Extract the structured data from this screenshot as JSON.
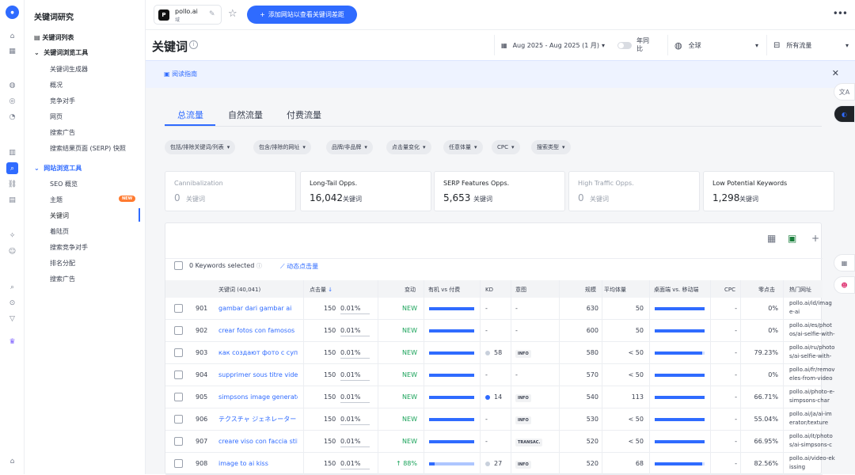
{
  "sidebar": {
    "title": "关键词研究",
    "sections": [
      {
        "label": "关键词列表"
      },
      {
        "label": "关键词浏览工具",
        "items": [
          "关键词生成器",
          "概况",
          "竞争对手",
          "网页",
          "搜索广告",
          "搜索结果页面 (SERP) 快照"
        ]
      },
      {
        "label": "网站浏览工具",
        "items": [
          "SEO 概览",
          "主题",
          "关键词",
          "着陆页",
          "搜索竞争对手",
          "排名分配",
          "搜索广告"
        ]
      }
    ],
    "new_badge": "NEW"
  },
  "topbar": {
    "domain": "pollo.ai",
    "domain_sub": "域",
    "add_button": "添加网站以查看关键词差距"
  },
  "header": {
    "title": "关键词",
    "date": "Aug 2025 - Aug 2025 (1 月)",
    "compare": "年同比",
    "region": "全球",
    "traffic": "所有流量"
  },
  "guide": {
    "label": "阅读指南"
  },
  "tabs": [
    "总流量",
    "自然流量",
    "付费流量"
  ],
  "filters": [
    "包括/排除关键词/列表",
    "包含/排除的网址",
    "品牌/非品牌",
    "点击量变化",
    "任意体量",
    "CPC",
    "搜索类型"
  ],
  "cards": [
    {
      "label": "Cannibalization",
      "value": "0",
      "unit": "关键词",
      "muted": true
    },
    {
      "label": "Long-Tail Opps.",
      "value": "16,042",
      "unit": "关键词",
      "muted": false
    },
    {
      "label": "SERP Features Opps.",
      "value": "5,653",
      "unit": "关键词",
      "muted": false
    },
    {
      "label": "High Traffic Opps.",
      "value": "0",
      "unit": "关键词",
      "muted": true
    },
    {
      "label": "Low Potential Keywords",
      "value": "1,298",
      "unit": "关键词",
      "muted": false
    }
  ],
  "table": {
    "selected": "0 Keywords selected",
    "dynamic": "动态点击量",
    "headers": [
      "关键词 (40,041)",
      "点击量",
      "变动",
      "有机 vs 付费",
      "KD",
      "意图",
      "规模",
      "平均体量",
      "桌面端 vs. 移动端",
      "CPC",
      "零点击",
      "热门网址"
    ],
    "rows": [
      {
        "n": "901",
        "kw": "gambar dari gambar ai",
        "clicks": "150",
        "share": "0.01%",
        "change": "NEW",
        "organic": 1.0,
        "kd": "-",
        "kd_color": "",
        "intent": "-",
        "volume": "630",
        "avg": "50",
        "desktop": 1.0,
        "cpc": "-",
        "zero": "0%",
        "url": "pollo.ai/id/image-ai"
      },
      {
        "n": "902",
        "kw": "crear fotos con famosos",
        "clicks": "150",
        "share": "0.01%",
        "change": "NEW",
        "organic": 1.0,
        "kd": "-",
        "kd_color": "",
        "intent": "-",
        "volume": "600",
        "avg": "50",
        "desktop": 1.0,
        "cpc": "-",
        "zero": "0%",
        "url": "pollo.ai/es/photos/ai-selfie-with-"
      },
      {
        "n": "903",
        "kw": "как создают фото с суперзвёздами",
        "clicks": "150",
        "share": "0.01%",
        "change": "NEW",
        "organic": 1.0,
        "kd": "58",
        "kd_color": "#c8d0dc",
        "intent": "INFO",
        "volume": "580",
        "avg": "< 50",
        "desktop": 0.95,
        "cpc": "-",
        "zero": "79.23%",
        "url": "pollo.ai/ru/photos/ai-selfie-with-"
      },
      {
        "n": "904",
        "kw": "supprimer sous titre video",
        "clicks": "150",
        "share": "0.01%",
        "change": "NEW",
        "organic": 1.0,
        "kd": "-",
        "kd_color": "",
        "intent": "-",
        "volume": "570",
        "avg": "< 50",
        "desktop": 1.0,
        "cpc": "-",
        "zero": "0%",
        "url": "pollo.ai/fr/removeles-from-video"
      },
      {
        "n": "905",
        "kw": "simpsons image generator",
        "clicks": "150",
        "share": "0.01%",
        "change": "NEW",
        "organic": 1.0,
        "kd": "14",
        "kd_color": "#2f6bff",
        "intent": "INFO",
        "volume": "540",
        "avg": "113",
        "desktop": 1.0,
        "cpc": "-",
        "zero": "66.71%",
        "url": "pollo.ai/photo-e-simpsons-char"
      },
      {
        "n": "906",
        "kw": "テクスチャ ジェネレーター",
        "clicks": "150",
        "share": "0.01%",
        "change": "NEW",
        "organic": 1.0,
        "kd": "-",
        "kd_color": "",
        "intent": "INFO",
        "volume": "530",
        "avg": "< 50",
        "desktop": 1.0,
        "cpc": "-",
        "zero": "55.04%",
        "url": "pollo.ai/ja/ai-imerator/texture"
      },
      {
        "n": "907",
        "kw": "creare viso con faccia stilizzata",
        "clicks": "150",
        "share": "0.01%",
        "change": "NEW",
        "organic": 1.0,
        "kd": "-",
        "kd_color": "",
        "intent": "TRANSAC.",
        "volume": "520",
        "avg": "< 50",
        "desktop": 1.0,
        "cpc": "-",
        "zero": "66.95%",
        "url": "pollo.ai/it/photos/ai-simpsons-c"
      },
      {
        "n": "908",
        "kw": "image to ai kiss",
        "clicks": "150",
        "share": "0.01%",
        "change": "↑ 88%",
        "organic": 0.12,
        "kd": "27",
        "kd_color": "#c8d0dc",
        "intent": "INFO",
        "volume": "520",
        "avg": "68",
        "desktop": 0.95,
        "cpc": "-",
        "zero": "82.56%",
        "url": "pollo.ai/video-ekissing"
      }
    ]
  }
}
